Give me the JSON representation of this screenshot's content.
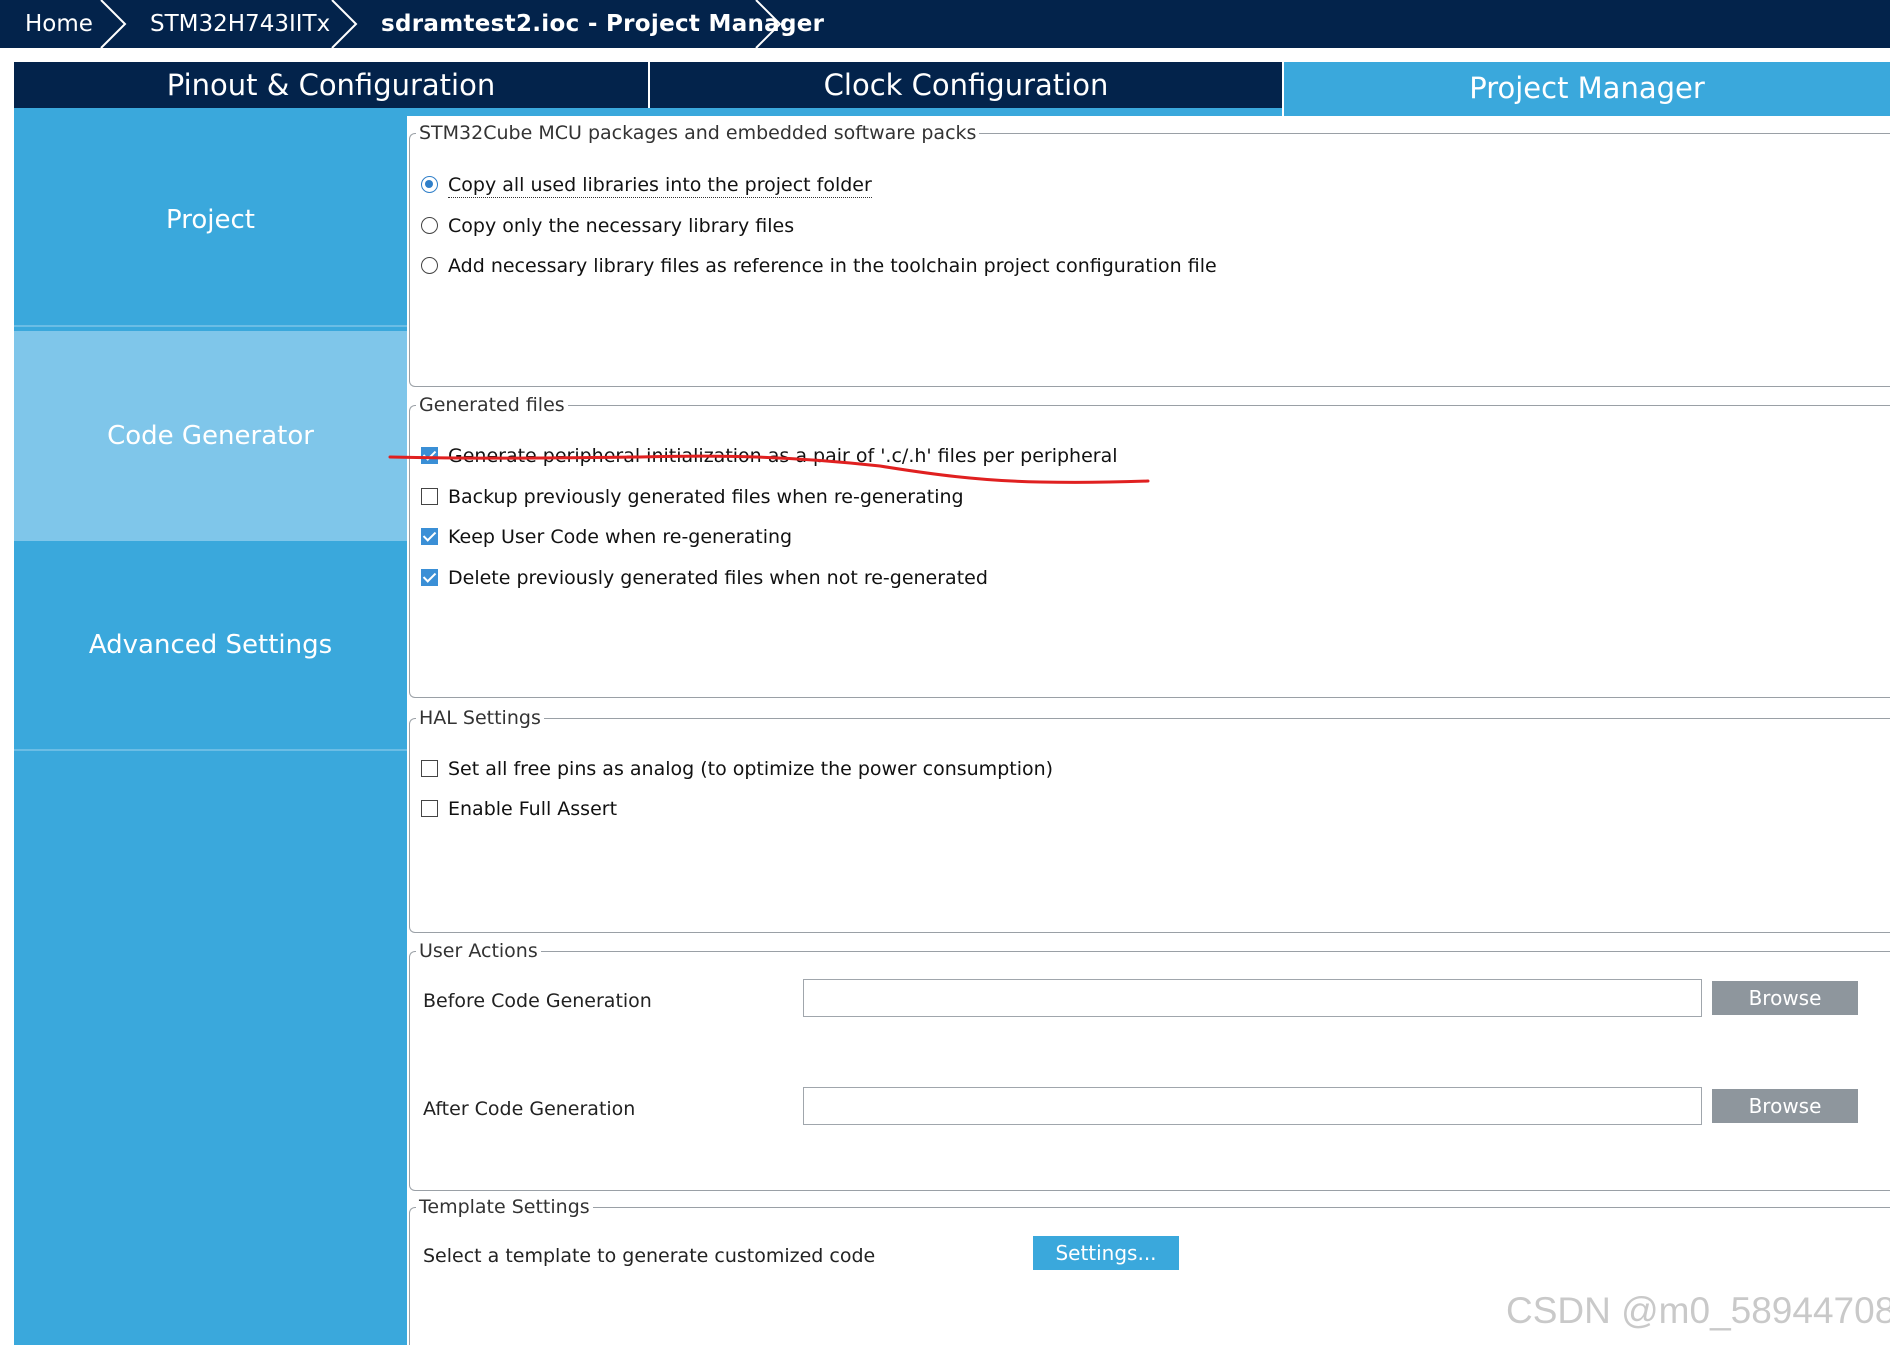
{
  "breadcrumb": {
    "items": [
      "Home",
      "STM32H743IITx",
      "sdramtest2.ioc - Project Manager"
    ]
  },
  "tabs": [
    {
      "label": "Pinout & Configuration",
      "active": false
    },
    {
      "label": "Clock Configuration",
      "active": false
    },
    {
      "label": "Project Manager",
      "active": true
    }
  ],
  "sidebar": {
    "items": [
      {
        "label": "Project",
        "active": false
      },
      {
        "label": "Code Generator",
        "active": true
      },
      {
        "label": "Advanced Settings",
        "active": false
      }
    ]
  },
  "packs": {
    "title": "STM32Cube MCU packages and embedded software packs",
    "options": [
      {
        "label": "Copy all used libraries into the project folder",
        "selected": true
      },
      {
        "label": "Copy only the necessary library files",
        "selected": false
      },
      {
        "label": "Add necessary library files as reference in the toolchain project configuration file",
        "selected": false
      }
    ]
  },
  "generated_files": {
    "title": "Generated files",
    "options": [
      {
        "label": "Generate peripheral initialization as a pair of '.c/.h' files per peripheral",
        "checked": true
      },
      {
        "label": "Backup previously generated files when re-generating",
        "checked": false
      },
      {
        "label": "Keep User Code when re-generating",
        "checked": true
      },
      {
        "label": "Delete previously generated files when not re-generated",
        "checked": true
      }
    ]
  },
  "hal": {
    "title": "HAL Settings",
    "options": [
      {
        "label": "Set all free pins as analog (to optimize the power consumption)",
        "checked": false
      },
      {
        "label": "Enable Full Assert",
        "checked": false
      }
    ]
  },
  "user_actions": {
    "title": "User Actions",
    "before_label": "Before Code Generation",
    "before_value": "",
    "after_label": "After Code Generation",
    "after_value": "",
    "browse_label": "Browse"
  },
  "template": {
    "title": "Template Settings",
    "label": "Select a template to generate customized code",
    "button_label": "Settings..."
  },
  "watermark": "CSDN @m0_58944708",
  "colors": {
    "navy": "#03234b",
    "accent_blue": "#3aa8dc",
    "selected_side": "#7fc6ea",
    "annotation_red": "#e02020"
  }
}
